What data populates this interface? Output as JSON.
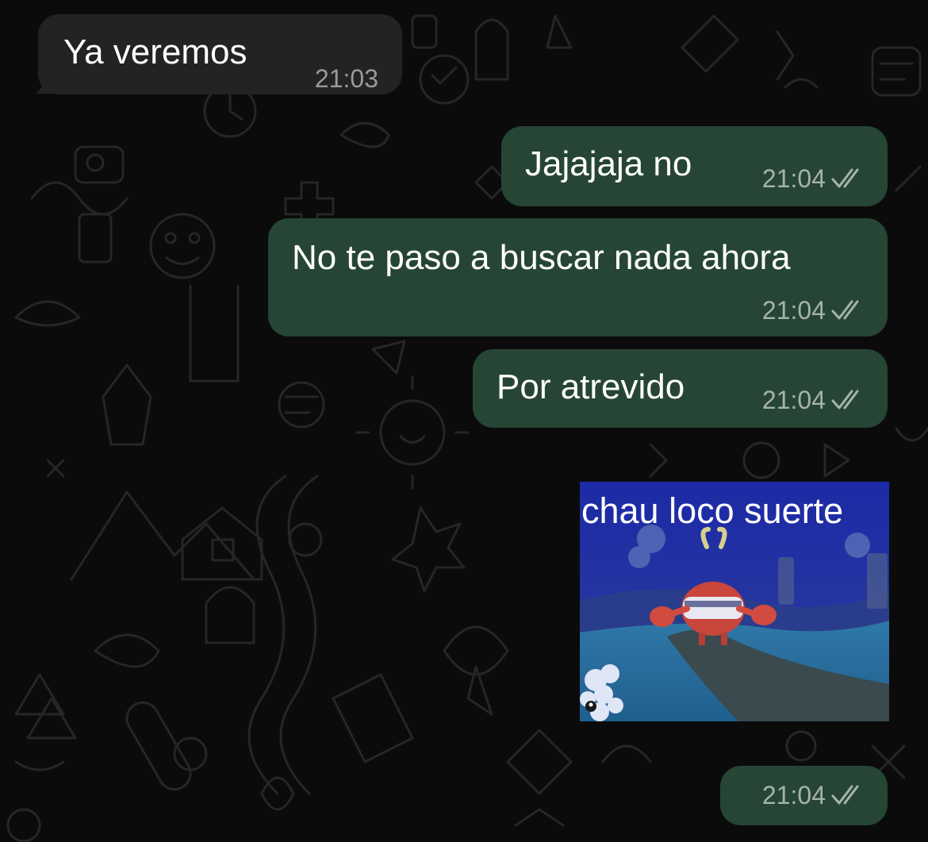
{
  "messages": [
    {
      "direction": "incoming",
      "text": "Ya veremos",
      "time": "21:03"
    },
    {
      "direction": "outgoing",
      "text": "Jajajaja no",
      "time": "21:04",
      "status": "read"
    },
    {
      "direction": "outgoing",
      "text": "No te paso a buscar nada ahora",
      "time": "21:04",
      "status": "read"
    },
    {
      "direction": "outgoing",
      "text": "Por atrevido",
      "time": "21:04",
      "status": "read"
    },
    {
      "direction": "outgoing",
      "type": "sticker",
      "sticker_caption": "chau loco suerte",
      "time": "21:04",
      "status": "read"
    }
  ],
  "icons": {
    "read_receipt": "double-check-icon"
  },
  "colors": {
    "background": "#0b0b0b",
    "incoming_bubble": "#232323",
    "outgoing_bubble": "#264535",
    "timestamp": "#a6b3ab"
  }
}
